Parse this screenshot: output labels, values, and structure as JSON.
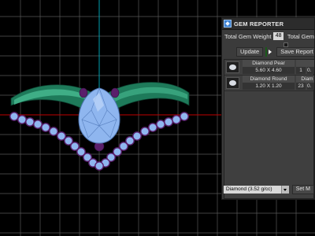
{
  "panel": {
    "title": "GEM REPORTER",
    "total_weight_label": "Total Gem Weight",
    "total_weight_value": "48",
    "total_weight_label2": "Total Gem",
    "update_label": "Update",
    "save_label": "Save Report",
    "gems": [
      {
        "name": "Diamond Pear",
        "size": "5.60 X 4.60",
        "count": "1",
        "weight": "0.",
        "extra": ""
      },
      {
        "name": "Diamond Round",
        "size": "1.20 X 1.20",
        "count": "23",
        "weight": "0.",
        "extra": "Diam"
      }
    ],
    "material_select": "Diamond    (3.52 g/cc)",
    "set_label": "Set M"
  },
  "colors": {
    "grid": "#5a5a5a",
    "axis_red": "#c00000",
    "axis_cyan": "#00a0b0",
    "band_green": "#1f7d5c",
    "gem_blue": "#8fb6ef",
    "accent_purple": "#5a1f6b"
  }
}
